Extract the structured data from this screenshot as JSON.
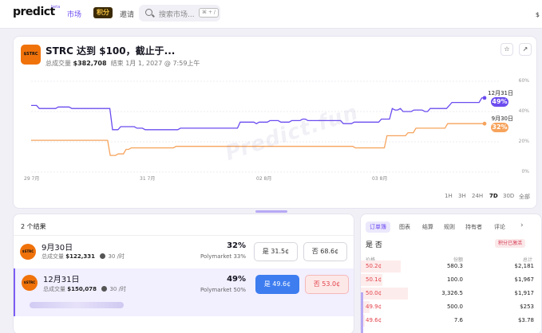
{
  "nav": {
    "logo": "predict",
    "beta": "beta",
    "market": "市场",
    "points": "积分",
    "invite": "邀请",
    "search_placeholder": "搜索市场...",
    "search_kbd": "⌘ + /",
    "right_text": "$"
  },
  "market": {
    "icon_text": "$STRC",
    "title": "STRC 达到 $100，截止于...",
    "volume_label": "总成交量",
    "volume": "$382,708",
    "end_label": "结束 1月 1, 2027 @ 7:59上午"
  },
  "chart_data": {
    "type": "line",
    "watermark": "Predict.fun",
    "y_ticks": [
      "60%",
      "40%",
      "20%",
      "0%"
    ],
    "ylim": [
      0,
      60
    ],
    "x_ticks": [
      "29 7月",
      "31 7月",
      "02 8月",
      "03 8月"
    ],
    "series": [
      {
        "name": "12月31日",
        "color": "#6c4cef",
        "last_value": "49%",
        "values": [
          44,
          44,
          44,
          42,
          42,
          42,
          42,
          42,
          42,
          42,
          43,
          43,
          43,
          43,
          43,
          42,
          42,
          42,
          42,
          42,
          42,
          42,
          42,
          42,
          42,
          42,
          42,
          42,
          42,
          42,
          28,
          28,
          28,
          30,
          30,
          30,
          30,
          30,
          30,
          29,
          29,
          29,
          28,
          28,
          28,
          28,
          28,
          28,
          28,
          28,
          28,
          28,
          28,
          28,
          28,
          29,
          29,
          29,
          29,
          29,
          29,
          29,
          29,
          29,
          29,
          29,
          29,
          29,
          29,
          29,
          29,
          29,
          29,
          29,
          29,
          29,
          29,
          33,
          33,
          33,
          33,
          33,
          33,
          32,
          33,
          33,
          33,
          33,
          34,
          34,
          34,
          34,
          33,
          33,
          33,
          33,
          34,
          34,
          34,
          34,
          35,
          35,
          34,
          34,
          34,
          34,
          34,
          34,
          34,
          34,
          34,
          34,
          34,
          34,
          34,
          32,
          32,
          32,
          32,
          33,
          33,
          33,
          33,
          33,
          33,
          33,
          33,
          33,
          33,
          35,
          35,
          35,
          35,
          42,
          41,
          41,
          42,
          40,
          40,
          40,
          40,
          41,
          41,
          41,
          41,
          40,
          40,
          42,
          42,
          42,
          42,
          42,
          42,
          42,
          44,
          46,
          46,
          46,
          46,
          46,
          46,
          46,
          46,
          46,
          46,
          46,
          49,
          49
        ]
      },
      {
        "name": "9月30日",
        "color": "#f6a35c",
        "last_value": "32%",
        "values": [
          21,
          21,
          21,
          21,
          21,
          21,
          21,
          21,
          21,
          21,
          21,
          21,
          21,
          21,
          21,
          21,
          21,
          21,
          21,
          21,
          21,
          21,
          21,
          21,
          21,
          21,
          21,
          21,
          21,
          21,
          11,
          11,
          11,
          12,
          12,
          12,
          15,
          15,
          16,
          16,
          16,
          16,
          16,
          16,
          16,
          16,
          16,
          16,
          16,
          16,
          16,
          16,
          16,
          16,
          16,
          17,
          17,
          17,
          17,
          17,
          17,
          17,
          17,
          17,
          17,
          17,
          17,
          17,
          17,
          17,
          17,
          17,
          17,
          17,
          17,
          17,
          17,
          17,
          17,
          17,
          17,
          17,
          17,
          17,
          17,
          17,
          17,
          17,
          17,
          17,
          17,
          17,
          17,
          17,
          17,
          17,
          17,
          17,
          17,
          17,
          17,
          17,
          17,
          17,
          17,
          17,
          17,
          17,
          17,
          17,
          17,
          17,
          17,
          17,
          17,
          17,
          17,
          17,
          17,
          17,
          17,
          17,
          17,
          16,
          16,
          16,
          16,
          16,
          16,
          16,
          16,
          16,
          16,
          16,
          16,
          24,
          24,
          24,
          24,
          24,
          24,
          24,
          24,
          26,
          26,
          26,
          29,
          29,
          29,
          29,
          29,
          29,
          29,
          29,
          29,
          29,
          29,
          29,
          32,
          32,
          32,
          32,
          32,
          32,
          32,
          32,
          32,
          32,
          32,
          32,
          32,
          32,
          32
        ]
      }
    ]
  },
  "ranges": [
    "1H",
    "3H",
    "24H",
    "7D",
    "30D",
    "全部"
  ],
  "results": {
    "count_label": "2 个结果",
    "rows": [
      {
        "icon_text": "$STRC",
        "title": "9月30日",
        "volume_label": "总成交量",
        "volume": "$122,331",
        "liquidity": "30 /时",
        "pct": "32%",
        "poly": "Polymarket 33%",
        "yes": "是 31.5¢",
        "no": "否 68.6¢"
      },
      {
        "icon_text": "$STRC",
        "title": "12月31日",
        "volume_label": "总成交量",
        "volume": "$150,078",
        "liquidity": "30 /时",
        "pct": "49%",
        "poly": "Polymarket 50%",
        "yes": "是 49.6¢",
        "no": "否 53.0¢"
      }
    ]
  },
  "book": {
    "tabs": [
      "订单簿",
      "图表",
      "结算",
      "规则",
      "持有者",
      "评论"
    ],
    "yes": "是",
    "no": "否",
    "points_badge": "积分已激活",
    "col_price": "价格",
    "col_size": "份额",
    "col_total": "总计",
    "rows": [
      {
        "price": "50.2¢",
        "size": "580.3",
        "total": "$2,181",
        "depth": 0.22
      },
      {
        "price": "50.1¢",
        "size": "100.0",
        "total": "$1,967",
        "depth": 0.12
      },
      {
        "price": "50.0¢",
        "size": "3,326.5",
        "total": "$1,917",
        "depth": 0.26
      },
      {
        "price": "49.9¢",
        "size": "500.0",
        "total": "$253",
        "depth": 0.05
      },
      {
        "price": "49.6¢",
        "size": "7.6",
        "total": "$3.78",
        "depth": 0.02
      }
    ]
  }
}
